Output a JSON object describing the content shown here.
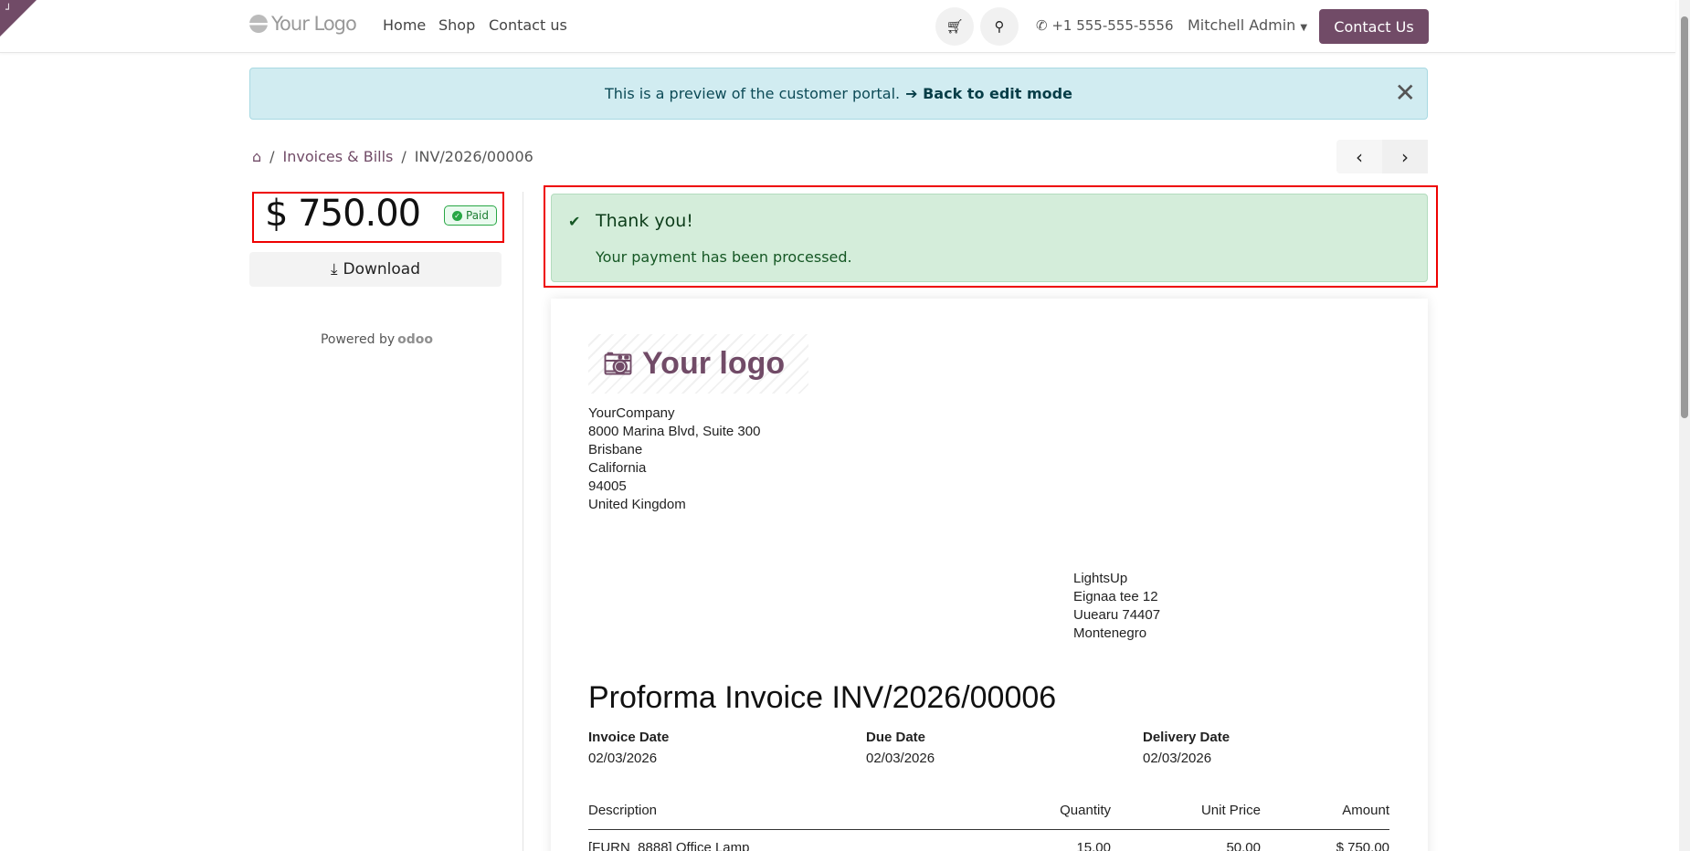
{
  "nav": {
    "logo": "Your Logo",
    "links": [
      "Home",
      "Shop",
      "Contact us"
    ],
    "phone": "+1 555-555-5556",
    "user": "Mitchell Admin",
    "cta": "Contact Us"
  },
  "banner": {
    "text": "This is a preview of the customer portal.",
    "link": "➔ Back to edit mode"
  },
  "breadcrumb": {
    "section": "Invoices & Bills",
    "current": "INV/2026/00006"
  },
  "sidebar": {
    "amount": "$ 750.00",
    "status": "Paid",
    "download": "Download",
    "powered": "Powered by",
    "brand": "odoo"
  },
  "alert": {
    "title": "Thank you!",
    "message": "Your payment has been processed."
  },
  "invoice": {
    "logo": "Your logo",
    "company": [
      "YourCompany",
      "8000 Marina Blvd, Suite 300",
      "Brisbane",
      "California",
      "94005",
      "United Kingdom"
    ],
    "customer": [
      "LightsUp",
      "Eignaa tee 12",
      "Uuearu 74407",
      "Montenegro"
    ],
    "title": "Proforma Invoice INV/2026/00006",
    "dates": [
      {
        "label": "Invoice Date",
        "value": "02/03/2026"
      },
      {
        "label": "Due Date",
        "value": "02/03/2026"
      },
      {
        "label": "Delivery Date",
        "value": "02/03/2026"
      }
    ],
    "columns": [
      "Description",
      "Quantity",
      "Unit Price",
      "Amount"
    ],
    "rows": [
      {
        "description": "[FURN_8888] Office Lamp",
        "quantity": "15.00",
        "unit_price": "50.00",
        "amount": "$ 750.00"
      }
    ]
  },
  "colors": {
    "brand": "#714b67",
    "highlight": "#ee0000"
  }
}
